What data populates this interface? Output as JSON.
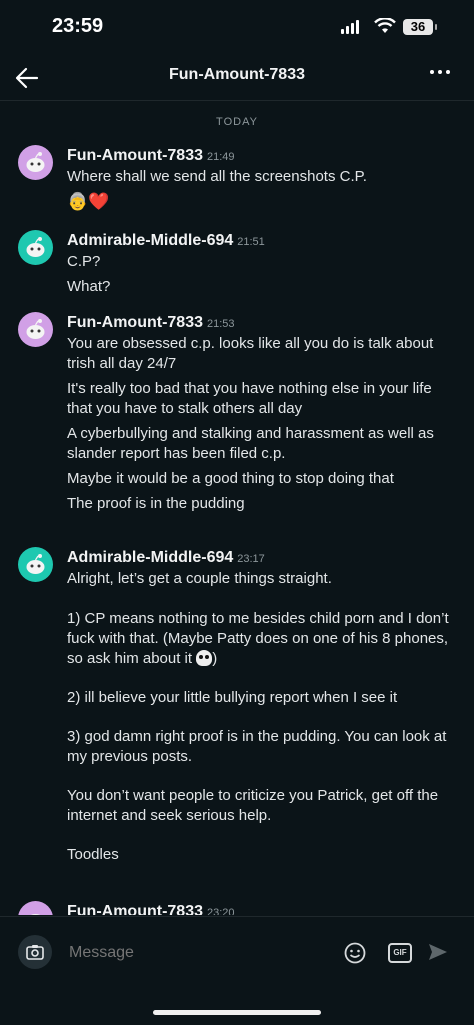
{
  "status": {
    "time": "23:59",
    "battery": "36"
  },
  "header": {
    "title": "Fun-Amount-7833"
  },
  "divider": "TODAY",
  "messages": [
    {
      "user": "Fun-Amount-7833",
      "time": "21:49",
      "avatar": "pink",
      "lines": [
        "Where shall we send all the screenshots C.P.",
        "👵❤️"
      ]
    },
    {
      "user": "Admirable-Middle-694",
      "time": "21:51",
      "avatar": "teal",
      "lines": [
        "C.P?",
        "What?"
      ]
    },
    {
      "user": "Fun-Amount-7833",
      "time": "21:53",
      "avatar": "pink",
      "lines": [
        "You are obsessed c.p. looks like all you do is talk about trish all day 24/7",
        "It's really too bad that you have nothing else in your life that you have to stalk others all day",
        "A cyberbullying and stalking and harassment as well as slander report has been filed c.p.",
        "Maybe it would be a good thing to stop doing that",
        "The proof is in the pudding"
      ]
    },
    {
      "user": "Admirable-Middle-694",
      "time": "23:17",
      "avatar": "teal",
      "lines": [
        "Alright, let’s get a couple things straight.\n\n1) CP means nothing to me besides child porn and I don’t fuck with that. (Maybe Patty does on one of his 8 phones, so ask him about it ",
        "2) ill believe your little bullying report when I see it",
        "3) god damn right proof is in the pudding. You can look at my previous posts.",
        "You don’t want people to criticize you Patrick, get off the internet and seek serious help.",
        "Toodles"
      ]
    },
    {
      "user": "Fun-Amount-7833",
      "time": "23:20",
      "avatar": "pink",
      "lines": []
    }
  ],
  "composer": {
    "placeholder": "Message",
    "gif_label": "GIF"
  }
}
